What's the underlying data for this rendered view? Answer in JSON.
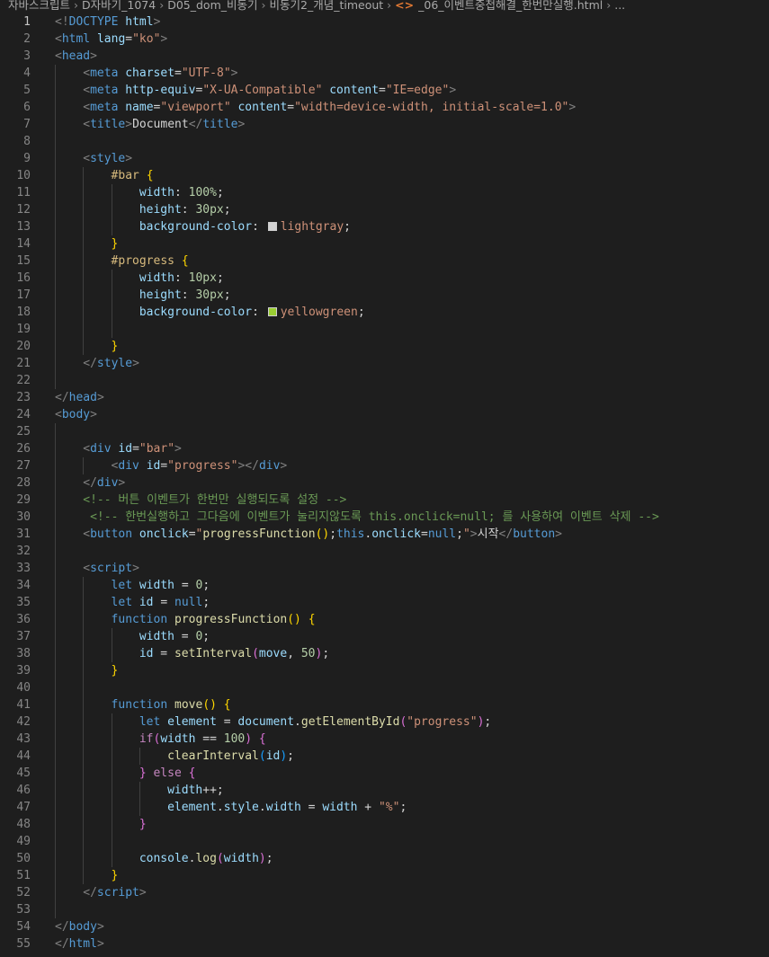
{
  "breadcrumb": [
    "자바스크립트",
    "D자바기_1074",
    "D05_dom_비동기",
    "비동기2_개념_timeout",
    "_06_이벤트중첩해결_한번만실행.html",
    "..."
  ],
  "editor": {
    "active_line": 1,
    "lines": [
      {
        "indent": 0,
        "tokens": [
          [
            "punct",
            "<!"
          ],
          [
            "tag",
            "DOCTYPE"
          ],
          [
            "text",
            " "
          ],
          [
            "attr",
            "html"
          ],
          [
            "punct",
            ">"
          ]
        ]
      },
      {
        "indent": 0,
        "tokens": [
          [
            "punct",
            "<"
          ],
          [
            "tag",
            "html"
          ],
          [
            "text",
            " "
          ],
          [
            "attr",
            "lang"
          ],
          [
            "text",
            "="
          ],
          [
            "str",
            "\"ko\""
          ],
          [
            "punct",
            ">"
          ]
        ]
      },
      {
        "indent": 0,
        "tokens": [
          [
            "punct",
            "<"
          ],
          [
            "tag",
            "head"
          ],
          [
            "punct",
            ">"
          ]
        ]
      },
      {
        "indent": 1,
        "tokens": [
          [
            "punct",
            "<"
          ],
          [
            "tag",
            "meta"
          ],
          [
            "text",
            " "
          ],
          [
            "attr",
            "charset"
          ],
          [
            "text",
            "="
          ],
          [
            "str",
            "\"UTF-8\""
          ],
          [
            "punct",
            ">"
          ]
        ]
      },
      {
        "indent": 1,
        "tokens": [
          [
            "punct",
            "<"
          ],
          [
            "tag",
            "meta"
          ],
          [
            "text",
            " "
          ],
          [
            "attr",
            "http-equiv"
          ],
          [
            "text",
            "="
          ],
          [
            "str",
            "\"X-UA-Compatible\""
          ],
          [
            "text",
            " "
          ],
          [
            "attr",
            "content"
          ],
          [
            "text",
            "="
          ],
          [
            "str",
            "\"IE=edge\""
          ],
          [
            "punct",
            ">"
          ]
        ]
      },
      {
        "indent": 1,
        "tokens": [
          [
            "punct",
            "<"
          ],
          [
            "tag",
            "meta"
          ],
          [
            "text",
            " "
          ],
          [
            "attr",
            "name"
          ],
          [
            "text",
            "="
          ],
          [
            "str",
            "\"viewport\""
          ],
          [
            "text",
            " "
          ],
          [
            "attr",
            "content"
          ],
          [
            "text",
            "="
          ],
          [
            "str",
            "\"width=device-width, initial-scale=1.0\""
          ],
          [
            "punct",
            ">"
          ]
        ]
      },
      {
        "indent": 1,
        "tokens": [
          [
            "punct",
            "<"
          ],
          [
            "tag",
            "title"
          ],
          [
            "punct",
            ">"
          ],
          [
            "text",
            "Document"
          ],
          [
            "punct",
            "</"
          ],
          [
            "tag",
            "title"
          ],
          [
            "punct",
            ">"
          ]
        ]
      },
      {
        "indent": 1,
        "tokens": []
      },
      {
        "indent": 1,
        "tokens": [
          [
            "punct",
            "<"
          ],
          [
            "tag",
            "style"
          ],
          [
            "punct",
            ">"
          ]
        ]
      },
      {
        "indent": 2,
        "tokens": [
          [
            "sel",
            "#bar"
          ],
          [
            "text",
            " "
          ],
          [
            "b1",
            "{"
          ]
        ]
      },
      {
        "indent": 3,
        "tokens": [
          [
            "prop",
            "width"
          ],
          [
            "text",
            ": "
          ],
          [
            "num",
            "100%"
          ],
          [
            "text",
            ";"
          ]
        ]
      },
      {
        "indent": 3,
        "tokens": [
          [
            "prop",
            "height"
          ],
          [
            "text",
            ": "
          ],
          [
            "num",
            "30px"
          ],
          [
            "text",
            ";"
          ]
        ]
      },
      {
        "indent": 3,
        "tokens": [
          [
            "prop",
            "background-color"
          ],
          [
            "text",
            ": "
          ],
          [
            "swatch",
            "#d3d3d3"
          ],
          [
            "str",
            "lightgray"
          ],
          [
            "text",
            ";"
          ]
        ]
      },
      {
        "indent": 2,
        "tokens": [
          [
            "b1",
            "}"
          ]
        ]
      },
      {
        "indent": 2,
        "tokens": [
          [
            "sel",
            "#progress"
          ],
          [
            "text",
            " "
          ],
          [
            "b1",
            "{"
          ]
        ]
      },
      {
        "indent": 3,
        "tokens": [
          [
            "prop",
            "width"
          ],
          [
            "text",
            ": "
          ],
          [
            "num",
            "10px"
          ],
          [
            "text",
            ";"
          ]
        ]
      },
      {
        "indent": 3,
        "tokens": [
          [
            "prop",
            "height"
          ],
          [
            "text",
            ": "
          ],
          [
            "num",
            "30px"
          ],
          [
            "text",
            ";"
          ]
        ]
      },
      {
        "indent": 3,
        "tokens": [
          [
            "prop",
            "background-color"
          ],
          [
            "text",
            ": "
          ],
          [
            "swatch",
            "#9acd32"
          ],
          [
            "str",
            "yellowgreen"
          ],
          [
            "text",
            ";"
          ]
        ]
      },
      {
        "indent": 3,
        "tokens": []
      },
      {
        "indent": 2,
        "tokens": [
          [
            "b1",
            "}"
          ]
        ]
      },
      {
        "indent": 1,
        "tokens": [
          [
            "punct",
            "</"
          ],
          [
            "tag",
            "style"
          ],
          [
            "punct",
            ">"
          ]
        ]
      },
      {
        "indent": 1,
        "tokens": []
      },
      {
        "indent": 0,
        "tokens": [
          [
            "punct",
            "</"
          ],
          [
            "tag",
            "head"
          ],
          [
            "punct",
            ">"
          ]
        ]
      },
      {
        "indent": 0,
        "tokens": [
          [
            "punct",
            "<"
          ],
          [
            "tag",
            "body"
          ],
          [
            "punct",
            ">"
          ]
        ]
      },
      {
        "indent": 1,
        "tokens": []
      },
      {
        "indent": 1,
        "tokens": [
          [
            "punct",
            "<"
          ],
          [
            "tag",
            "div"
          ],
          [
            "text",
            " "
          ],
          [
            "attr",
            "id"
          ],
          [
            "text",
            "="
          ],
          [
            "str",
            "\"bar\""
          ],
          [
            "punct",
            ">"
          ]
        ]
      },
      {
        "indent": 2,
        "tokens": [
          [
            "punct",
            "<"
          ],
          [
            "tag",
            "div"
          ],
          [
            "text",
            " "
          ],
          [
            "attr",
            "id"
          ],
          [
            "text",
            "="
          ],
          [
            "str",
            "\"progress\""
          ],
          [
            "punct",
            "></"
          ],
          [
            "tag",
            "div"
          ],
          [
            "punct",
            ">"
          ]
        ]
      },
      {
        "indent": 1,
        "tokens": [
          [
            "punct",
            "</"
          ],
          [
            "tag",
            "div"
          ],
          [
            "punct",
            ">"
          ]
        ]
      },
      {
        "indent": 1,
        "tokens": [
          [
            "cmt",
            "<!-- 버튼 이벤트가 한번만 실행되도록 설정 -->"
          ]
        ]
      },
      {
        "indent": 1,
        "tokens": [
          [
            "cmt",
            " <!-- 한번실행하고 그다음에 이벤트가 눌리지않도록 this.onclick=null; 를 사용하여 이벤트 삭제 -->"
          ]
        ]
      },
      {
        "indent": 1,
        "tokens": [
          [
            "punct",
            "<"
          ],
          [
            "tag",
            "button"
          ],
          [
            "text",
            " "
          ],
          [
            "attr",
            "onclick"
          ],
          [
            "text",
            "="
          ],
          [
            "str",
            "\""
          ],
          [
            "fn",
            "progressFunction"
          ],
          [
            "b1",
            "()"
          ],
          [
            "text",
            ";"
          ],
          [
            "kw",
            "this"
          ],
          [
            "text",
            "."
          ],
          [
            "var",
            "onclick"
          ],
          [
            "text",
            "="
          ],
          [
            "kw",
            "null"
          ],
          [
            "text",
            ";"
          ],
          [
            "str",
            "\""
          ],
          [
            "punct",
            ">"
          ],
          [
            "text",
            "시작"
          ],
          [
            "punct",
            "</"
          ],
          [
            "tag",
            "button"
          ],
          [
            "punct",
            ">"
          ]
        ]
      },
      {
        "indent": 1,
        "tokens": []
      },
      {
        "indent": 1,
        "tokens": [
          [
            "punct",
            "<"
          ],
          [
            "tag",
            "script"
          ],
          [
            "punct",
            ">"
          ]
        ]
      },
      {
        "indent": 2,
        "tokens": [
          [
            "kw",
            "let"
          ],
          [
            "text",
            " "
          ],
          [
            "var",
            "width"
          ],
          [
            "text",
            " = "
          ],
          [
            "num",
            "0"
          ],
          [
            "text",
            ";"
          ]
        ]
      },
      {
        "indent": 2,
        "tokens": [
          [
            "kw",
            "let"
          ],
          [
            "text",
            " "
          ],
          [
            "var",
            "id"
          ],
          [
            "text",
            " = "
          ],
          [
            "kw",
            "null"
          ],
          [
            "text",
            ";"
          ]
        ]
      },
      {
        "indent": 2,
        "tokens": [
          [
            "kw",
            "function"
          ],
          [
            "text",
            " "
          ],
          [
            "fn",
            "progressFunction"
          ],
          [
            "b1",
            "()"
          ],
          [
            "text",
            " "
          ],
          [
            "b1",
            "{"
          ]
        ]
      },
      {
        "indent": 3,
        "tokens": [
          [
            "var",
            "width"
          ],
          [
            "text",
            " = "
          ],
          [
            "num",
            "0"
          ],
          [
            "text",
            ";"
          ]
        ]
      },
      {
        "indent": 3,
        "tokens": [
          [
            "var",
            "id"
          ],
          [
            "text",
            " = "
          ],
          [
            "fn",
            "setInterval"
          ],
          [
            "b2",
            "("
          ],
          [
            "var",
            "move"
          ],
          [
            "text",
            ", "
          ],
          [
            "num",
            "50"
          ],
          [
            "b2",
            ")"
          ],
          [
            "text",
            ";"
          ]
        ]
      },
      {
        "indent": 2,
        "tokens": [
          [
            "b1",
            "}"
          ]
        ]
      },
      {
        "indent": 2,
        "tokens": []
      },
      {
        "indent": 2,
        "tokens": [
          [
            "kw",
            "function"
          ],
          [
            "text",
            " "
          ],
          [
            "fn",
            "move"
          ],
          [
            "b1",
            "()"
          ],
          [
            "text",
            " "
          ],
          [
            "b1",
            "{"
          ]
        ]
      },
      {
        "indent": 3,
        "tokens": [
          [
            "kw",
            "let"
          ],
          [
            "text",
            " "
          ],
          [
            "var",
            "element"
          ],
          [
            "text",
            " = "
          ],
          [
            "var",
            "document"
          ],
          [
            "text",
            "."
          ],
          [
            "fn",
            "getElementById"
          ],
          [
            "b2",
            "("
          ],
          [
            "str",
            "\"progress\""
          ],
          [
            "b2",
            ")"
          ],
          [
            "text",
            ";"
          ]
        ]
      },
      {
        "indent": 3,
        "tokens": [
          [
            "ctl",
            "if"
          ],
          [
            "b2",
            "("
          ],
          [
            "var",
            "width"
          ],
          [
            "text",
            " == "
          ],
          [
            "num",
            "100"
          ],
          [
            "b2",
            ")"
          ],
          [
            "text",
            " "
          ],
          [
            "b2",
            "{"
          ]
        ]
      },
      {
        "indent": 4,
        "tokens": [
          [
            "fn",
            "clearInterval"
          ],
          [
            "b3",
            "("
          ],
          [
            "var",
            "id"
          ],
          [
            "b3",
            ")"
          ],
          [
            "text",
            ";"
          ]
        ]
      },
      {
        "indent": 3,
        "tokens": [
          [
            "b2",
            "}"
          ],
          [
            "text",
            " "
          ],
          [
            "ctl",
            "else"
          ],
          [
            "text",
            " "
          ],
          [
            "b2",
            "{"
          ]
        ]
      },
      {
        "indent": 4,
        "tokens": [
          [
            "var",
            "width"
          ],
          [
            "text",
            "++;"
          ]
        ]
      },
      {
        "indent": 4,
        "tokens": [
          [
            "var",
            "element"
          ],
          [
            "text",
            "."
          ],
          [
            "var",
            "style"
          ],
          [
            "text",
            "."
          ],
          [
            "var",
            "width"
          ],
          [
            "text",
            " = "
          ],
          [
            "var",
            "width"
          ],
          [
            "text",
            " + "
          ],
          [
            "str",
            "\"%\""
          ],
          [
            "text",
            ";"
          ]
        ]
      },
      {
        "indent": 3,
        "tokens": [
          [
            "b2",
            "}"
          ]
        ]
      },
      {
        "indent": 3,
        "tokens": []
      },
      {
        "indent": 3,
        "tokens": [
          [
            "var",
            "console"
          ],
          [
            "text",
            "."
          ],
          [
            "fn",
            "log"
          ],
          [
            "b2",
            "("
          ],
          [
            "var",
            "width"
          ],
          [
            "b2",
            ")"
          ],
          [
            "text",
            ";"
          ]
        ]
      },
      {
        "indent": 2,
        "tokens": [
          [
            "b1",
            "}"
          ]
        ]
      },
      {
        "indent": 1,
        "tokens": [
          [
            "punct",
            "</"
          ],
          [
            "tag",
            "script"
          ],
          [
            "punct",
            ">"
          ]
        ]
      },
      {
        "indent": 1,
        "tokens": []
      },
      {
        "indent": 0,
        "tokens": [
          [
            "punct",
            "</"
          ],
          [
            "tag",
            "body"
          ],
          [
            "punct",
            ">"
          ]
        ]
      },
      {
        "indent": 0,
        "tokens": [
          [
            "punct",
            "</"
          ],
          [
            "tag",
            "html"
          ],
          [
            "punct",
            ">"
          ]
        ]
      }
    ]
  }
}
